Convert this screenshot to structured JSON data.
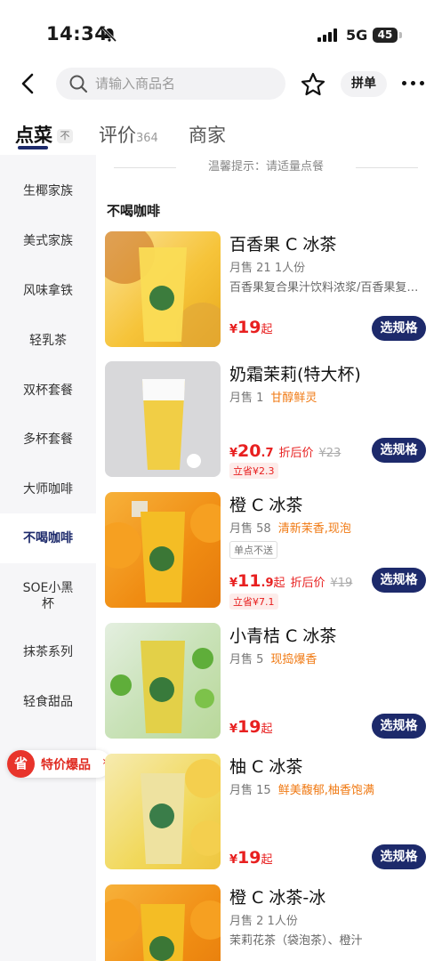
{
  "status_bar": {
    "time": "14:34",
    "network": "5G",
    "battery": "45"
  },
  "header": {
    "search_placeholder": "请输入商品名",
    "group_order_label": "拼单"
  },
  "tabs": {
    "menu": "点菜",
    "menu_pin": "不",
    "reviews": "评价",
    "review_count": "364",
    "shop": "商家"
  },
  "sidebar": {
    "items": [
      {
        "label": "生椰家族",
        "active": false
      },
      {
        "label": "美式家族",
        "active": false
      },
      {
        "label": "风味拿铁",
        "active": false
      },
      {
        "label": "轻乳茶",
        "active": false
      },
      {
        "label": "双杯套餐",
        "active": false
      },
      {
        "label": "多杯套餐",
        "active": false
      },
      {
        "label": "大师咖啡",
        "active": false
      },
      {
        "label": "不喝咖啡",
        "active": true
      },
      {
        "label": "SOE小黑杯",
        "active": false
      },
      {
        "label": "抹茶系列",
        "active": false
      },
      {
        "label": "轻食甜品",
        "active": false
      }
    ]
  },
  "promo": {
    "icon_text": "省",
    "label": "特价爆品",
    "arrow": "›"
  },
  "tip": "温馨提示：请适量点餐",
  "category_title": "不喝咖啡",
  "products": [
    {
      "name": "百香果 C 冰茶",
      "sales": "月售 21",
      "serving": "1人份",
      "highlight": "",
      "desc": "百香果复合果汁饮料浓浆/百香果复合果汁",
      "tag": "",
      "currency": "¥",
      "price_int": "19",
      "price_dec": "",
      "qi": "起",
      "discount_label": "",
      "original_price": "",
      "save_label": "",
      "button": "选规格",
      "color": "#f5c21a"
    },
    {
      "name": "奶霜茉莉(特大杯)",
      "sales": "月售 1",
      "serving": "",
      "highlight": "甘醇鲜灵",
      "desc": "",
      "tag": "",
      "currency": "¥",
      "price_int": "20",
      "price_dec": ".7",
      "qi": "",
      "discount_label": "折后价",
      "original_price": "¥23",
      "save_label": "立省¥2.3",
      "button": "选规格",
      "color": "#f3d35a"
    },
    {
      "name": "橙 C 冰茶",
      "sales": "月售 58",
      "serving": "",
      "highlight": "清新茉香,现泡",
      "desc": "",
      "tag": "单点不送",
      "currency": "¥",
      "price_int": "11",
      "price_dec": ".9",
      "qi": "起",
      "discount_label": "折后价",
      "original_price": "¥19",
      "save_label": "立省¥7.1",
      "button": "选规格",
      "color": "#f2a818"
    },
    {
      "name": "小青桔 C 冰茶",
      "sales": "月售 5",
      "serving": "",
      "highlight": "现捣爆香",
      "desc": "",
      "tag": "",
      "currency": "¥",
      "price_int": "19",
      "price_dec": "",
      "qi": "起",
      "discount_label": "",
      "original_price": "",
      "save_label": "",
      "button": "选规格",
      "color": "#d9c93a"
    },
    {
      "name": "柚 C 冰茶",
      "sales": "月售 15",
      "serving": "",
      "highlight": "鲜美馥郁,柚香饱满",
      "desc": "",
      "tag": "",
      "currency": "¥",
      "price_int": "19",
      "price_dec": "",
      "qi": "起",
      "discount_label": "",
      "original_price": "",
      "save_label": "",
      "button": "选规格",
      "color": "#e9d860"
    },
    {
      "name": "橙 C 冰茶-冰",
      "sales": "月售 2",
      "serving": "1人份",
      "highlight": "",
      "desc": "茉莉花茶（袋泡茶）、橙汁",
      "tag": "",
      "currency": "",
      "price_int": "",
      "price_dec": "",
      "qi": "",
      "discount_label": "",
      "original_price": "",
      "save_label": "",
      "button": "",
      "color": "#f2a818"
    }
  ]
}
